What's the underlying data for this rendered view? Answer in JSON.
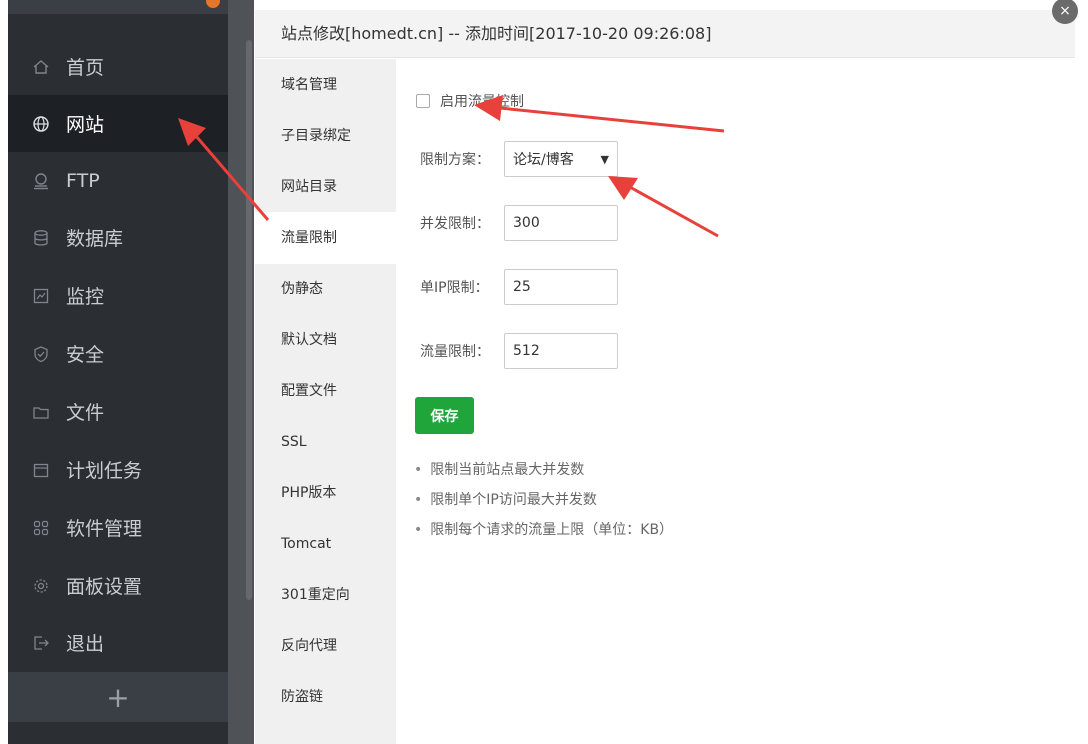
{
  "sidebar": {
    "items": [
      {
        "label": "首页",
        "icon": "home-icon",
        "active": false
      },
      {
        "label": "网站",
        "icon": "globe-icon",
        "active": true
      },
      {
        "label": "FTP",
        "icon": "ftp-icon",
        "active": false
      },
      {
        "label": "数据库",
        "icon": "database-icon",
        "active": false
      },
      {
        "label": "监控",
        "icon": "monitor-icon",
        "active": false
      },
      {
        "label": "安全",
        "icon": "shield-icon",
        "active": false
      },
      {
        "label": "文件",
        "icon": "folder-icon",
        "active": false
      },
      {
        "label": "计划任务",
        "icon": "calendar-icon",
        "active": false
      },
      {
        "label": "软件管理",
        "icon": "grid-icon",
        "active": false
      },
      {
        "label": "面板设置",
        "icon": "gear-icon",
        "active": false
      },
      {
        "label": "退出",
        "icon": "logout-icon",
        "active": false
      }
    ],
    "add_label": "+"
  },
  "modal": {
    "title": "站点修改[homedt.cn] -- 添加时间[2017-10-20 09:26:08]",
    "close_label": "×"
  },
  "tabs": [
    {
      "label": "域名管理",
      "active": false
    },
    {
      "label": "子目录绑定",
      "active": false
    },
    {
      "label": "网站目录",
      "active": false
    },
    {
      "label": "流量限制",
      "active": true
    },
    {
      "label": "伪静态",
      "active": false
    },
    {
      "label": "默认文档",
      "active": false
    },
    {
      "label": "配置文件",
      "active": false
    },
    {
      "label": "SSL",
      "active": false
    },
    {
      "label": "PHP版本",
      "active": false
    },
    {
      "label": "Tomcat",
      "active": false
    },
    {
      "label": "301重定向",
      "active": false
    },
    {
      "label": "反向代理",
      "active": false
    },
    {
      "label": "防盗链",
      "active": false
    }
  ],
  "form": {
    "enable_label": "启用流量控制",
    "enabled": false,
    "scheme_label": "限制方案：",
    "scheme_value": "论坛/博客",
    "concurrency_label": "并发限制：",
    "concurrency_value": "300",
    "per_ip_label": "单IP限制：",
    "per_ip_value": "25",
    "rate_label": "流量限制：",
    "rate_value": "512",
    "save_label": "保存"
  },
  "tips": [
    "限制当前站点最大并发数",
    "限制单个IP访问最大并发数",
    "限制每个请求的流量上限（单位：KB）"
  ],
  "colors": {
    "sidebar_bg": "#2b2f34",
    "sidebar_active_bg": "#1d2024",
    "accent_green": "#20a53a",
    "annotation_red": "#e8403a"
  }
}
